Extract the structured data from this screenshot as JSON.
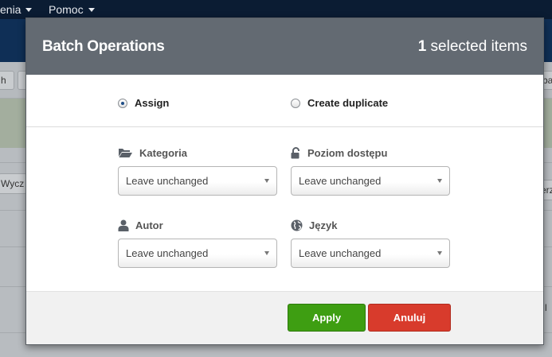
{
  "background": {
    "menu": [
      {
        "label": "enia"
      },
      {
        "label": "Pomoc"
      }
    ],
    "toolbar_fragments": {
      "left": "h",
      "right": "ba"
    },
    "filter_fragments": {
      "left": "Wycz",
      "right": "erz"
    },
    "row_fragment": "l"
  },
  "modal": {
    "title": "Batch Operations",
    "selected_count": "1",
    "selected_suffix": " selected items",
    "radios": [
      {
        "label": "Assign",
        "checked": true
      },
      {
        "label": "Create duplicate",
        "checked": false
      }
    ],
    "fields": {
      "kategoria": {
        "label": "Kategoria",
        "icon": "folder-open-icon",
        "value": "Leave unchanged"
      },
      "poziom": {
        "label": "Poziom dostępu",
        "icon": "unlock-icon",
        "value": "Leave unchanged"
      },
      "autor": {
        "label": "Autor",
        "icon": "user-icon",
        "value": "Leave unchanged"
      },
      "jezyk": {
        "label": "Język",
        "icon": "globe-icon",
        "value": "Leave unchanged"
      }
    },
    "buttons": {
      "apply": {
        "label": "Apply",
        "color": "#3e9e12"
      },
      "cancel": {
        "label": "Anuluj",
        "color": "#d83b2c"
      }
    },
    "header_color": "#636a72"
  }
}
